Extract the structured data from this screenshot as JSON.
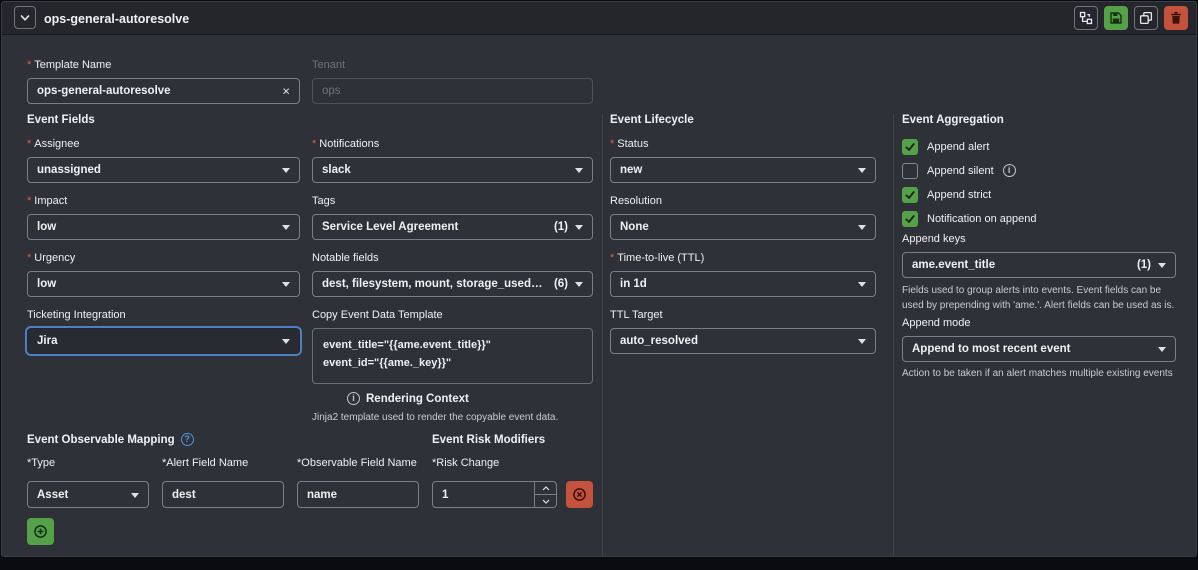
{
  "header": {
    "title": "ops-general-autoresolve"
  },
  "top": {
    "template_name": {
      "label": "Template Name",
      "value": "ops-general-autoresolve",
      "required": true
    },
    "tenant": {
      "label": "Tenant",
      "placeholder": "ops",
      "disabled": true
    }
  },
  "event_fields": {
    "heading": "Event Fields",
    "assignee": {
      "label": "Assignee",
      "value": "unassigned",
      "required": true
    },
    "impact": {
      "label": "Impact",
      "value": "low",
      "required": true
    },
    "urgency": {
      "label": "Urgency",
      "value": "low",
      "required": true
    },
    "ticketing_integration": {
      "label": "Ticketing Integration",
      "value": "Jira",
      "focused": true
    },
    "notifications": {
      "label": "Notifications",
      "value": "slack",
      "required": true
    },
    "tags": {
      "label": "Tags",
      "value": "Service Level Agreement",
      "count": "(1)"
    },
    "notable_fields": {
      "label": "Notable fields",
      "value": "dest, filesystem, mount, storage_used_percent...",
      "count": "(6)"
    },
    "copy_event_data_template": {
      "label": "Copy Event Data Template",
      "value": "event_title=\"{{ame.event_title}}\"\nevent_id=\"{{ame._key}}\""
    },
    "rendering_context": {
      "label": "Rendering Context",
      "help": "Jinja2 template used to render the copyable event data."
    }
  },
  "event_lifecycle": {
    "heading": "Event Lifecycle",
    "status": {
      "label": "Status",
      "value": "new",
      "required": true
    },
    "resolution": {
      "label": "Resolution",
      "value": "None"
    },
    "ttl": {
      "label": "Time-to-live (TTL)",
      "value": "in 1d",
      "required": true
    },
    "ttl_target": {
      "label": "TTL Target",
      "value": "auto_resolved"
    }
  },
  "event_aggregation": {
    "heading": "Event Aggregation",
    "append_alert": {
      "label": "Append alert",
      "checked": true
    },
    "append_silent": {
      "label": "Append silent",
      "checked": false
    },
    "append_strict": {
      "label": "Append strict",
      "checked": true
    },
    "notification_on_append": {
      "label": "Notification on append",
      "checked": true
    },
    "append_keys": {
      "label": "Append keys",
      "value": "ame.event_title",
      "count": "(1)",
      "help": "Fields used to group alerts into events. Event fields can be used by prepending with 'ame.'. Alert fields can be used as is."
    },
    "append_mode": {
      "label": "Append mode",
      "value": "Append to most recent event",
      "help": "Action to be taken if an alert matches multiple existing events"
    }
  },
  "observable_mapping": {
    "heading": "Event Observable Mapping",
    "type": {
      "label": "*Type",
      "value": "Asset"
    },
    "alert_field_name": {
      "label": "*Alert Field Name",
      "value": "dest"
    },
    "observable_field_name": {
      "label": "*Observable Field Name",
      "value": "name"
    }
  },
  "risk_modifiers": {
    "heading": "Event Risk Modifiers",
    "risk_change": {
      "label": "*Risk Change",
      "value": "1"
    }
  },
  "icons": {
    "clear": "×",
    "help": "?",
    "info": "i"
  },
  "colors": {
    "accent_green": "#55a149",
    "danger_red": "#c4523d",
    "focus_blue": "#4c7fc4",
    "help_blue": "#4f94e8",
    "required_star": "#e25a40",
    "panel_bg": "#2e3138",
    "header_bg": "#24262c"
  }
}
